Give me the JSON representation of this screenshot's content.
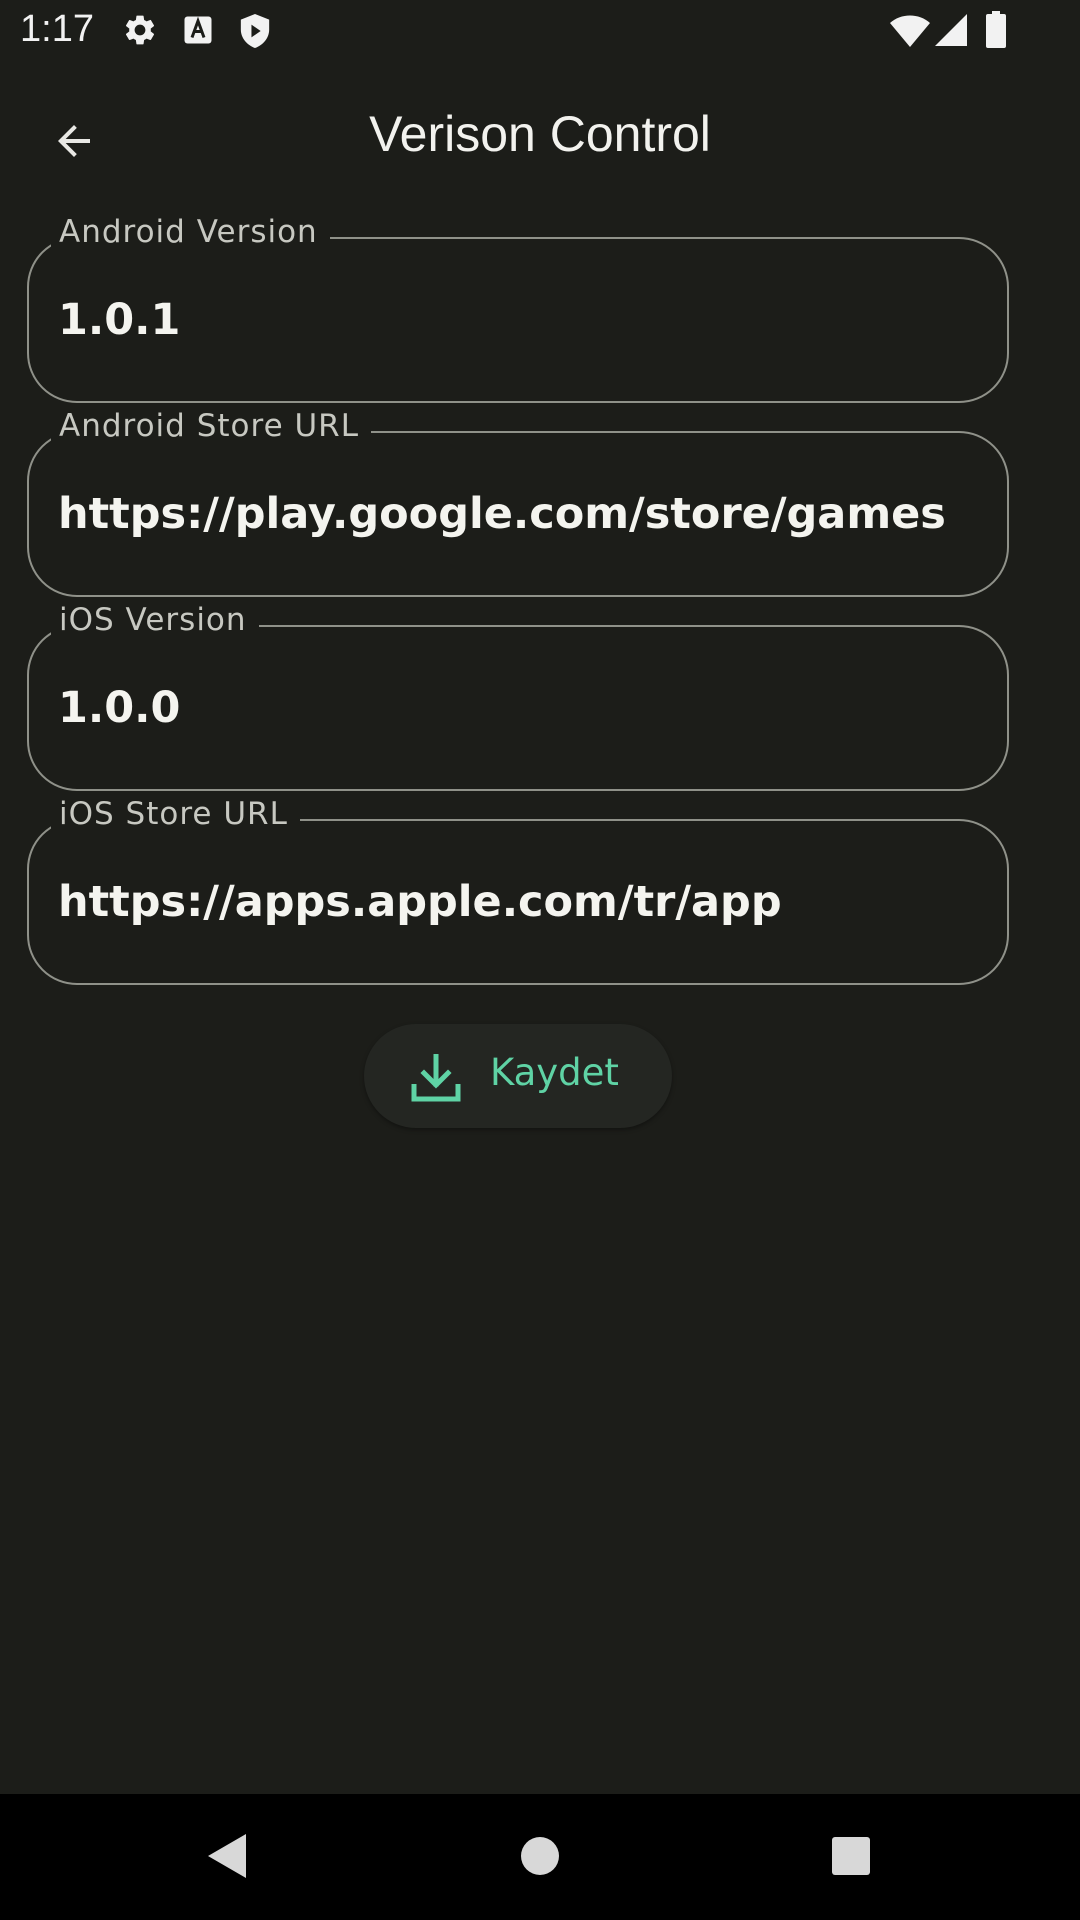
{
  "status_bar": {
    "time": "1:17",
    "left_icons": [
      "gear-icon",
      "font-download-icon",
      "shield-play-icon"
    ],
    "right_icons": [
      "wifi-icon",
      "cell-signal-icon",
      "battery-icon"
    ]
  },
  "app_bar": {
    "title": "Verison Control",
    "back_icon": "arrow-back-icon"
  },
  "form": {
    "fields": [
      {
        "label": "Android Version",
        "value": "1.0.1"
      },
      {
        "label": "Android Store URL",
        "value": "https://play.google.com/store/games"
      },
      {
        "label": "iOS Version",
        "value": "1.0.0"
      },
      {
        "label": "iOS Store URL",
        "value": "https://apps.apple.com/tr/app"
      }
    ]
  },
  "save_button": {
    "label": "Kaydet",
    "icon": "download-icon",
    "accent_color": "#5fd3a5"
  },
  "nav_bar": {
    "buttons": [
      "back-triangle-icon",
      "home-circle-icon",
      "recents-square-icon"
    ]
  },
  "colors": {
    "background": "#1c1d19",
    "field_border": "#8f9189",
    "nav_background": "#000000"
  }
}
